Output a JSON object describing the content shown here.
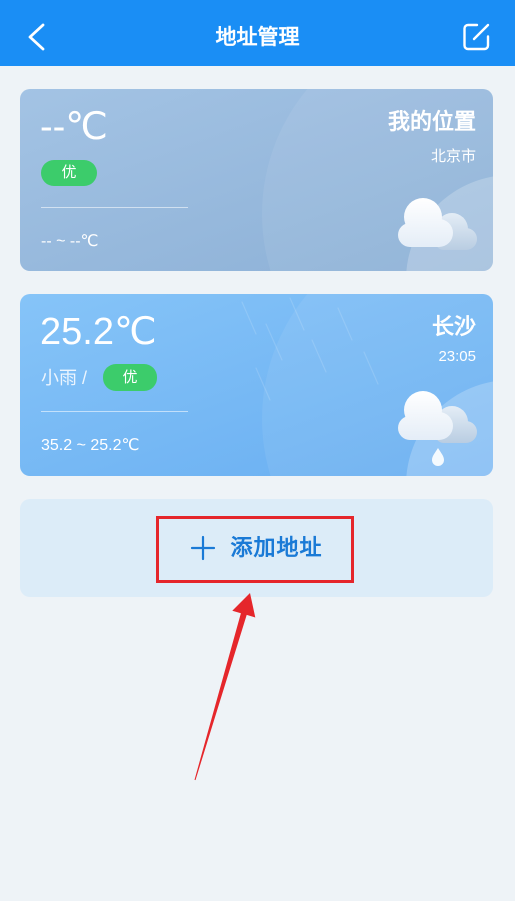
{
  "header": {
    "title": "地址管理",
    "back_icon": "chevron-left-icon",
    "edit_icon": "edit-icon"
  },
  "locations": [
    {
      "temperature": "--℃",
      "aqi": "优",
      "range": "-- ~ --℃",
      "name": "我的位置",
      "subtitle": "北京市",
      "weather_icon": "cloud-icon"
    },
    {
      "temperature": "25.2℃",
      "condition": "小雨 /",
      "aqi": "优",
      "range": "35.2 ~ 25.2℃",
      "name": "长沙",
      "time": "23:05",
      "weather_icon": "cloud-rain-icon"
    }
  ],
  "add_address": {
    "label": "添加地址",
    "icon": "plus-icon"
  },
  "colors": {
    "header_bg": "#1a8ef5",
    "page_bg": "#eef3f7",
    "aqi_good": "#3ccc6b",
    "accent": "#1a7ad6",
    "annotation": "#e5262b"
  }
}
